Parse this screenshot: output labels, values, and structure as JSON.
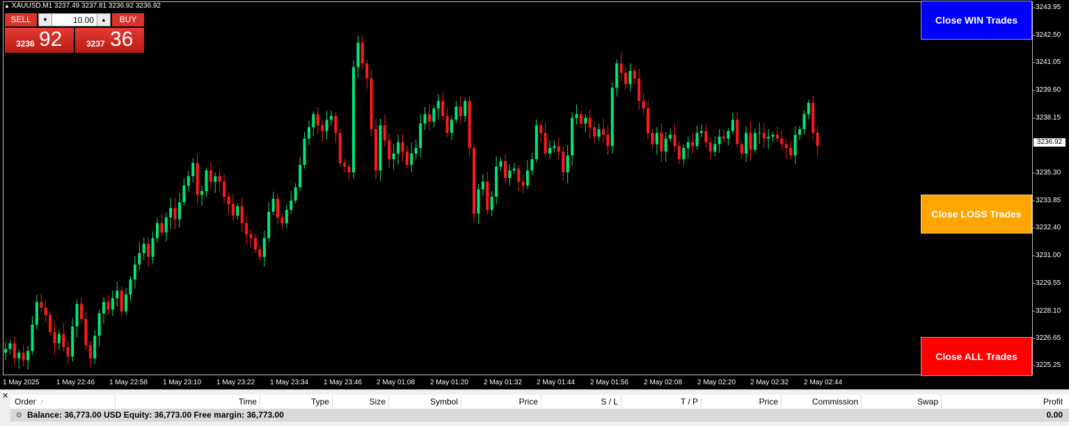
{
  "symbol_line": "XAUUSD,M1  3237.49 3237.81 3236.92 3236.92",
  "trade_panel": {
    "sell_label": "SELL",
    "buy_label": "BUY",
    "lot": "10.00",
    "sell_small": "3236",
    "sell_big": "92",
    "buy_small": "3237",
    "buy_big": "36"
  },
  "buttons": {
    "close_win": "Close WIN Trades",
    "close_loss": "Close LOSS Trades",
    "close_all": "Close ALL Trades"
  },
  "price_axis": [
    "3243.95",
    "3242.50",
    "3241.05",
    "3239.60",
    "3238.15",
    "3235.30",
    "3233.85",
    "3232.40",
    "3231.00",
    "3229.55",
    "3228.10",
    "3226.65",
    "3225.25"
  ],
  "current_price": "3236.92",
  "time_axis": [
    "1 May 2025",
    "1 May 22:46",
    "1 May 22:58",
    "1 May 23:10",
    "1 May 23:22",
    "1 May 23:34",
    "1 May 23:46",
    "2 May 01:08",
    "2 May 01:20",
    "2 May 01:32",
    "2 May 01:44",
    "2 May 01:56",
    "2 May 02:08",
    "2 May 02:20",
    "2 May 02:32",
    "2 May 02:44"
  ],
  "terminal": {
    "close_glyph": "✕",
    "columns": [
      "Order",
      "Time",
      "Type",
      "Size",
      "Symbol",
      "Price",
      "S / L",
      "T / P",
      "Price",
      "Commission",
      "Swap",
      "Profit"
    ],
    "balance_text": "Balance: 36,773.00 USD  Equity: 36,773.00  Free margin: 36,773.00",
    "profit_total": "0.00"
  },
  "colors": {
    "background": "#000000",
    "bull": "#00e676",
    "bear": "#ff1a1a",
    "close_win": "#0000ff",
    "close_loss": "#ffa500",
    "close_all": "#ff0000"
  },
  "chart_data": {
    "type": "candlestick",
    "symbol": "XAUUSD",
    "timeframe": "M1",
    "ylim": [
      3224.7,
      3244.6
    ],
    "closes": [
      3226.1,
      3226.4,
      3225.6,
      3225.9,
      3225.5,
      3226.0,
      3227.4,
      3228.6,
      3228.3,
      3227.9,
      3227.0,
      3226.4,
      3226.9,
      3226.2,
      3225.7,
      3227.3,
      3228.5,
      3227.7,
      3226.3,
      3225.6,
      3226.8,
      3228.0,
      3228.6,
      3228.2,
      3228.8,
      3229.2,
      3228.1,
      3229.0,
      3229.8,
      3230.6,
      3231.2,
      3231.7,
      3231.0,
      3232.0,
      3232.8,
      3232.3,
      3233.1,
      3233.6,
      3233.0,
      3233.9,
      3234.8,
      3235.3,
      3236.0,
      3234.3,
      3234.5,
      3235.6,
      3235.0,
      3235.3,
      3235.0,
      3234.2,
      3233.8,
      3233.2,
      3233.7,
      3232.8,
      3232.2,
      3232.0,
      3231.4,
      3231.0,
      3232.0,
      3233.4,
      3234.1,
      3233.1,
      3232.8,
      3233.5,
      3234.0,
      3234.7,
      3235.9,
      3237.3,
      3237.9,
      3238.6,
      3238.0,
      3237.7,
      3238.3,
      3238.5,
      3237.6,
      3236.0,
      3235.8,
      3235.5,
      3241.1,
      3242.4,
      3241.3,
      3240.5,
      3237.8,
      3235.6,
      3238.0,
      3237.2,
      3236.2,
      3236.5,
      3237.1,
      3236.6,
      3235.9,
      3236.5,
      3236.8,
      3238.1,
      3238.6,
      3238.2,
      3238.9,
      3239.3,
      3238.5,
      3237.6,
      3238.3,
      3239.0,
      3238.5,
      3239.3,
      3236.8,
      3233.3,
      3234.6,
      3235.0,
      3233.5,
      3234.2,
      3235.8,
      3236.1,
      3235.2,
      3235.6,
      3235.7,
      3235.0,
      3234.8,
      3235.6,
      3236.2,
      3238.0,
      3237.6,
      3236.5,
      3236.8,
      3236.9,
      3236.6,
      3235.5,
      3236.4,
      3238.4,
      3238.6,
      3238.1,
      3238.4,
      3237.9,
      3237.4,
      3237.8,
      3237.5,
      3236.9,
      3240.0,
      3241.3,
      3240.8,
      3240.2,
      3240.9,
      3240.5,
      3239.3,
      3238.9,
      3237.6,
      3237.0,
      3237.6,
      3236.6,
      3237.3,
      3237.5,
      3236.9,
      3236.2,
      3236.8,
      3237.1,
      3236.9,
      3237.6,
      3237.7,
      3237.1,
      3236.6,
      3237.0,
      3237.4,
      3237.3,
      3237.7,
      3238.3,
      3237.0,
      3236.5,
      3237.6,
      3236.7,
      3237.6,
      3237.6,
      3237.3,
      3237.4,
      3237.5,
      3237.3,
      3237.0,
      3236.8,
      3236.4,
      3237.5,
      3237.8,
      3238.6,
      3239.2,
      3237.6,
      3236.9
    ]
  }
}
